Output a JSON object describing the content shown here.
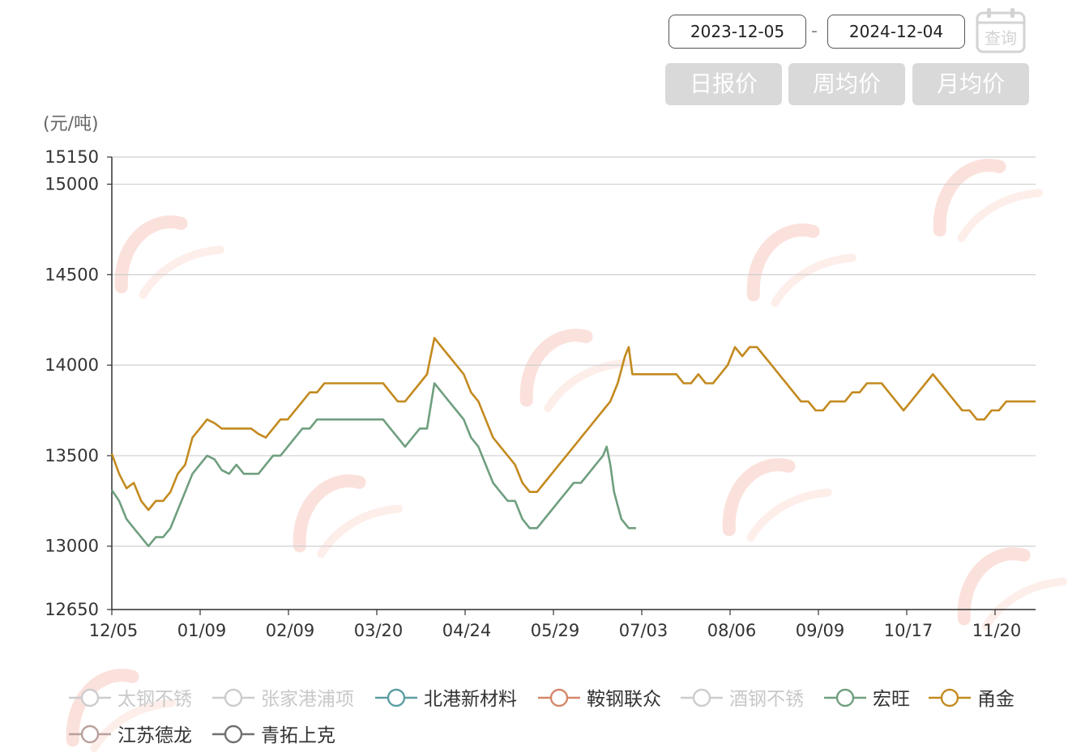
{
  "controls": {
    "start_date": "2023-12-05",
    "end_date": "2024-12-04",
    "separator": "-",
    "query_label": "查询",
    "tabs": [
      "日报价",
      "周均价",
      "月均价"
    ]
  },
  "chart_data": {
    "type": "line",
    "ylabel": "(元/吨)",
    "ylim": [
      12650,
      15150
    ],
    "yticks": [
      12650,
      13000,
      13500,
      14000,
      14500,
      15000,
      15150
    ],
    "xticks": [
      "12/05",
      "01/09",
      "02/09",
      "03/20",
      "04/24",
      "05/29",
      "07/03",
      "08/06",
      "09/09",
      "10/17",
      "11/20"
    ],
    "n_points": 253,
    "grid": true,
    "legend_position": "bottom",
    "series": [
      {
        "name": "太钢不锈",
        "color": "#cccccc",
        "visible": false,
        "values": []
      },
      {
        "name": "张家港浦项",
        "color": "#cccccc",
        "visible": false,
        "values": []
      },
      {
        "name": "北港新材料",
        "color": "#5b9ea3",
        "visible": true,
        "values": []
      },
      {
        "name": "鞍钢联众",
        "color": "#d4876a",
        "visible": true,
        "values": []
      },
      {
        "name": "酒钢不锈",
        "color": "#cccccc",
        "visible": false,
        "values": []
      },
      {
        "name": "宏旺",
        "color": "#6f9f7f",
        "visible": true,
        "values": [
          [
            0,
            13310
          ],
          [
            2,
            13250
          ],
          [
            4,
            13150
          ],
          [
            6,
            13100
          ],
          [
            8,
            13050
          ],
          [
            10,
            13000
          ],
          [
            12,
            13050
          ],
          [
            14,
            13050
          ],
          [
            16,
            13100
          ],
          [
            18,
            13200
          ],
          [
            20,
            13300
          ],
          [
            22,
            13400
          ],
          [
            24,
            13450
          ],
          [
            26,
            13500
          ],
          [
            28,
            13480
          ],
          [
            30,
            13420
          ],
          [
            32,
            13400
          ],
          [
            34,
            13450
          ],
          [
            36,
            13400
          ],
          [
            38,
            13400
          ],
          [
            40,
            13400
          ],
          [
            42,
            13450
          ],
          [
            44,
            13500
          ],
          [
            46,
            13500
          ],
          [
            48,
            13550
          ],
          [
            50,
            13600
          ],
          [
            52,
            13650
          ],
          [
            54,
            13650
          ],
          [
            56,
            13700
          ],
          [
            58,
            13700
          ],
          [
            60,
            13700
          ],
          [
            62,
            13700
          ],
          [
            64,
            13700
          ],
          [
            66,
            13700
          ],
          [
            68,
            13700
          ],
          [
            70,
            13700
          ],
          [
            72,
            13700
          ],
          [
            74,
            13700
          ],
          [
            76,
            13650
          ],
          [
            78,
            13600
          ],
          [
            80,
            13550
          ],
          [
            82,
            13600
          ],
          [
            84,
            13650
          ],
          [
            86,
            13650
          ],
          [
            88,
            13900
          ],
          [
            90,
            13850
          ],
          [
            92,
            13800
          ],
          [
            94,
            13750
          ],
          [
            96,
            13700
          ],
          [
            98,
            13600
          ],
          [
            100,
            13550
          ],
          [
            102,
            13450
          ],
          [
            104,
            13350
          ],
          [
            106,
            13300
          ],
          [
            108,
            13250
          ],
          [
            110,
            13250
          ],
          [
            112,
            13150
          ],
          [
            114,
            13100
          ],
          [
            116,
            13100
          ],
          [
            118,
            13150
          ],
          [
            120,
            13200
          ],
          [
            122,
            13250
          ],
          [
            124,
            13300
          ],
          [
            126,
            13350
          ],
          [
            128,
            13350
          ],
          [
            130,
            13400
          ],
          [
            132,
            13450
          ],
          [
            134,
            13500
          ],
          [
            135,
            13550
          ],
          [
            136,
            13450
          ],
          [
            137,
            13300
          ],
          [
            139,
            13150
          ],
          [
            141,
            13100
          ],
          [
            143,
            13100
          ]
        ]
      },
      {
        "name": "甬金",
        "color": "#c38a1f",
        "visible": true,
        "values": [
          [
            0,
            13510
          ],
          [
            2,
            13400
          ],
          [
            4,
            13320
          ],
          [
            6,
            13350
          ],
          [
            8,
            13250
          ],
          [
            10,
            13200
          ],
          [
            12,
            13250
          ],
          [
            14,
            13250
          ],
          [
            16,
            13300
          ],
          [
            18,
            13400
          ],
          [
            20,
            13450
          ],
          [
            22,
            13600
          ],
          [
            24,
            13650
          ],
          [
            26,
            13700
          ],
          [
            28,
            13680
          ],
          [
            30,
            13650
          ],
          [
            32,
            13650
          ],
          [
            34,
            13650
          ],
          [
            36,
            13650
          ],
          [
            38,
            13650
          ],
          [
            40,
            13620
          ],
          [
            42,
            13600
          ],
          [
            44,
            13650
          ],
          [
            46,
            13700
          ],
          [
            48,
            13700
          ],
          [
            50,
            13750
          ],
          [
            52,
            13800
          ],
          [
            54,
            13850
          ],
          [
            56,
            13850
          ],
          [
            58,
            13900
          ],
          [
            60,
            13900
          ],
          [
            62,
            13900
          ],
          [
            64,
            13900
          ],
          [
            66,
            13900
          ],
          [
            68,
            13900
          ],
          [
            70,
            13900
          ],
          [
            72,
            13900
          ],
          [
            74,
            13900
          ],
          [
            76,
            13850
          ],
          [
            78,
            13800
          ],
          [
            80,
            13800
          ],
          [
            82,
            13850
          ],
          [
            84,
            13900
          ],
          [
            86,
            13950
          ],
          [
            88,
            14150
          ],
          [
            90,
            14100
          ],
          [
            92,
            14050
          ],
          [
            94,
            14000
          ],
          [
            96,
            13950
          ],
          [
            98,
            13850
          ],
          [
            100,
            13800
          ],
          [
            102,
            13700
          ],
          [
            104,
            13600
          ],
          [
            106,
            13550
          ],
          [
            108,
            13500
          ],
          [
            110,
            13450
          ],
          [
            112,
            13350
          ],
          [
            114,
            13300
          ],
          [
            116,
            13300
          ],
          [
            118,
            13350
          ],
          [
            120,
            13400
          ],
          [
            122,
            13450
          ],
          [
            124,
            13500
          ],
          [
            126,
            13550
          ],
          [
            128,
            13600
          ],
          [
            130,
            13650
          ],
          [
            132,
            13700
          ],
          [
            134,
            13750
          ],
          [
            136,
            13800
          ],
          [
            138,
            13900
          ],
          [
            140,
            14050
          ],
          [
            141,
            14100
          ],
          [
            142,
            13950
          ],
          [
            144,
            13950
          ],
          [
            146,
            13950
          ],
          [
            148,
            13950
          ],
          [
            150,
            13950
          ],
          [
            152,
            13950
          ],
          [
            154,
            13950
          ],
          [
            156,
            13900
          ],
          [
            158,
            13900
          ],
          [
            160,
            13950
          ],
          [
            162,
            13900
          ],
          [
            164,
            13900
          ],
          [
            166,
            13950
          ],
          [
            168,
            14000
          ],
          [
            170,
            14100
          ],
          [
            172,
            14050
          ],
          [
            174,
            14100
          ],
          [
            176,
            14100
          ],
          [
            178,
            14050
          ],
          [
            180,
            14000
          ],
          [
            182,
            13950
          ],
          [
            184,
            13900
          ],
          [
            186,
            13850
          ],
          [
            188,
            13800
          ],
          [
            190,
            13800
          ],
          [
            192,
            13750
          ],
          [
            194,
            13750
          ],
          [
            196,
            13800
          ],
          [
            198,
            13800
          ],
          [
            200,
            13800
          ],
          [
            202,
            13850
          ],
          [
            204,
            13850
          ],
          [
            206,
            13900
          ],
          [
            208,
            13900
          ],
          [
            210,
            13900
          ],
          [
            212,
            13850
          ],
          [
            214,
            13800
          ],
          [
            216,
            13750
          ],
          [
            218,
            13800
          ],
          [
            220,
            13850
          ],
          [
            222,
            13900
          ],
          [
            224,
            13950
          ],
          [
            226,
            13900
          ],
          [
            228,
            13850
          ],
          [
            230,
            13800
          ],
          [
            232,
            13750
          ],
          [
            234,
            13750
          ],
          [
            236,
            13700
          ],
          [
            238,
            13700
          ],
          [
            240,
            13750
          ],
          [
            242,
            13750
          ],
          [
            244,
            13800
          ],
          [
            246,
            13800
          ],
          [
            248,
            13800
          ],
          [
            250,
            13800
          ],
          [
            252,
            13800
          ]
        ]
      },
      {
        "name": "江苏德龙",
        "color": "#b8a09a",
        "visible": true,
        "values": []
      },
      {
        "name": "青拓上克",
        "color": "#6e7072",
        "visible": true,
        "values": []
      }
    ]
  }
}
